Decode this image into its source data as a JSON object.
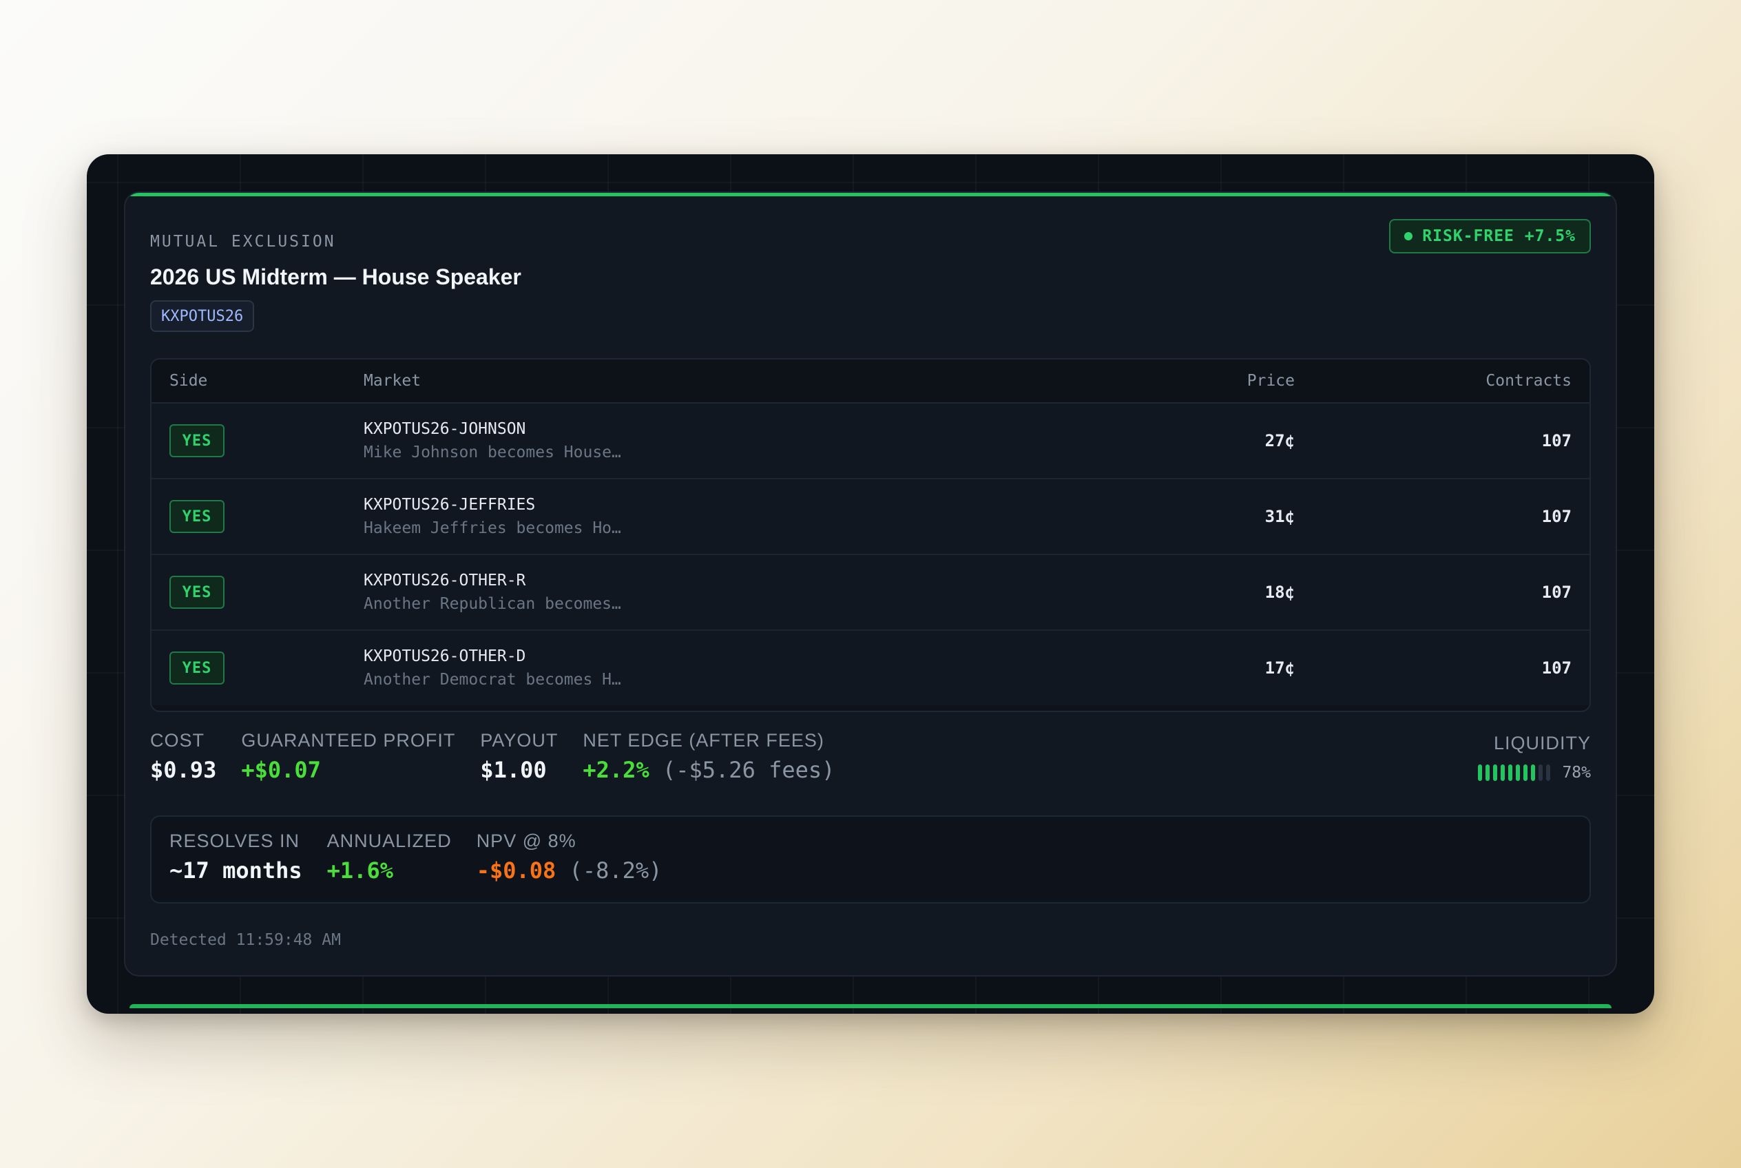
{
  "card": {
    "type_label": "MUTUAL EXCLUSION",
    "title": "2026 US Midterm — House Speaker",
    "ticker": "KXPOTUS26",
    "risk_badge": "RISK-FREE +7.5%"
  },
  "table": {
    "headers": {
      "side": "Side",
      "market": "Market",
      "price": "Price",
      "contracts": "Contracts"
    },
    "rows": [
      {
        "side": "YES",
        "ticker": "KXPOTUS26-JOHNSON",
        "desc": "Mike Johnson becomes House…",
        "price": "27¢",
        "contracts": "107"
      },
      {
        "side": "YES",
        "ticker": "KXPOTUS26-JEFFRIES",
        "desc": "Hakeem Jeffries becomes Ho…",
        "price": "31¢",
        "contracts": "107"
      },
      {
        "side": "YES",
        "ticker": "KXPOTUS26-OTHER-R",
        "desc": "Another Republican becomes…",
        "price": "18¢",
        "contracts": "107"
      },
      {
        "side": "YES",
        "ticker": "KXPOTUS26-OTHER-D",
        "desc": "Another Democrat becomes H…",
        "price": "17¢",
        "contracts": "107"
      }
    ]
  },
  "metrics": {
    "cost": {
      "label": "COST",
      "value": "$0.93"
    },
    "profit": {
      "label": "GUARANTEED PROFIT",
      "value": "+$0.07"
    },
    "payout": {
      "label": "PAYOUT",
      "value": "$1.00"
    },
    "edge": {
      "label": "NET EDGE (AFTER FEES)",
      "value": "+2.2%",
      "fees": "(-$5.26 fees)"
    },
    "liquidity": {
      "label": "LIQUIDITY",
      "percent_text": "78%",
      "fraction": 0.78
    }
  },
  "resolution": {
    "resolves": {
      "label": "RESOLVES IN",
      "value": "~17 months"
    },
    "annualized": {
      "label": "ANNUALIZED",
      "value": "+1.6%"
    },
    "npv": {
      "label": "NPV @ 8%",
      "value": "-$0.08",
      "pct": "(-8.2%)"
    }
  },
  "footer": {
    "detected": "Detected 11:59:48 AM"
  },
  "colors": {
    "accent": "#22c55e",
    "positive": "#4ade3a",
    "negative": "#f97316",
    "background": "#0c1017"
  }
}
